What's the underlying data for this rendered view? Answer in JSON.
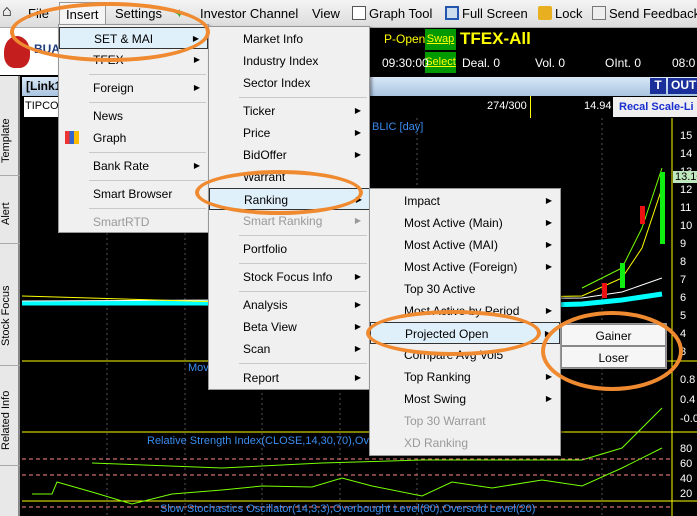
{
  "menubar": {
    "items": [
      "File",
      "Insert",
      "Settings",
      "Investor Channel",
      "View",
      "Graph Tool",
      "Full Screen",
      "Lock",
      "Send Feedback"
    ],
    "selected": "Insert"
  },
  "ticker": {
    "p_open": "P-Open",
    "swap": "Swap",
    "select": "Select",
    "market": "TFEX-All",
    "time": "09:30:00",
    "deal": "Deal. 0",
    "vol": "Vol. 0",
    "oint": "OInt. 0",
    "time2": "08:0"
  },
  "logo": {
    "text": "BUA"
  },
  "sidebar": {
    "tabs": [
      "Template",
      "Alert",
      "Stock Focus",
      "Related Info"
    ]
  },
  "window": {
    "title": "[Link1",
    "t_button": "T",
    "out_button": "OUT"
  },
  "chart_toolbar": {
    "symbol": "TIPCO",
    "count": "274/300",
    "value": "14.94",
    "recal": "Recal Scale-Li"
  },
  "chart": {
    "title_fragment": "BLIC [day]",
    "last_price": "13.10",
    "price_axis": [
      "15",
      "14",
      "13",
      "12",
      "11",
      "10",
      "9",
      "8",
      "7",
      "6",
      "5",
      "4",
      "3"
    ],
    "macd_axis": [
      "0.8",
      "0.4",
      "-0.0"
    ],
    "rsi_axis": [
      "80",
      "60",
      "40",
      "20"
    ],
    "mov_label": "Mov",
    "rsi_label": "Relative Strength Index(CLOSE,14,30,70),Over",
    "stoch_label": "Slow Stochastics Oscillator(14,3,3),Overbought Level(80),Oversold Level(20)"
  },
  "insert_menu": [
    {
      "label": "SET & MAI",
      "arrow": true
    },
    {
      "label": "TFEX",
      "arrow": true
    },
    {
      "label": "Foreign",
      "arrow": true
    },
    {
      "label": "News"
    },
    {
      "label": "Graph",
      "icon": "bar-chart-icon"
    },
    {
      "label": "Bank Rate",
      "arrow": true
    },
    {
      "label": "Smart Browser"
    },
    {
      "label": "SmartRTD",
      "disabled": true
    }
  ],
  "set_mai_menu": [
    {
      "label": "Market Info"
    },
    {
      "label": "Industry Index"
    },
    {
      "label": "Sector Index"
    },
    {
      "label": "Ticker",
      "arrow": true
    },
    {
      "label": "Price",
      "arrow": true
    },
    {
      "label": "BidOffer",
      "arrow": true
    },
    {
      "label": "Warrant"
    },
    {
      "label": "Ranking",
      "arrow": true
    },
    {
      "label": "Smart Ranking",
      "arrow": true,
      "disabled": true
    },
    {
      "label": "Portfolio"
    },
    {
      "label": "Stock Focus Info",
      "arrow": true
    },
    {
      "label": "Analysis",
      "arrow": true
    },
    {
      "label": "Beta View",
      "arrow": true
    },
    {
      "label": "Scan",
      "arrow": true
    },
    {
      "label": "Report",
      "arrow": true
    }
  ],
  "ranking_menu": [
    {
      "label": "Impact",
      "arrow": true
    },
    {
      "label": "Most Active (Main)",
      "arrow": true
    },
    {
      "label": "Most Active (MAI)",
      "arrow": true
    },
    {
      "label": "Most Active (Foreign)",
      "arrow": true
    },
    {
      "label": "Top 30 Active"
    },
    {
      "label": "Most Active by Period",
      "arrow": true
    },
    {
      "label": "Projected Open",
      "arrow": true
    },
    {
      "label": "Compare Avg Vol5"
    },
    {
      "label": "Top Ranking",
      "arrow": true
    },
    {
      "label": "Most Swing",
      "arrow": true
    },
    {
      "label": "Top 30 Warrant",
      "disabled": true
    },
    {
      "label": "XD Ranking",
      "disabled": true
    }
  ],
  "projected_open_menu": [
    "Gainer",
    "Loser"
  ],
  "colors": {
    "highlight_ring": "#f08a30",
    "menu_hover": "#e0f0fa",
    "ticker_yellow": "#ffff00",
    "button_green": "#009900"
  }
}
